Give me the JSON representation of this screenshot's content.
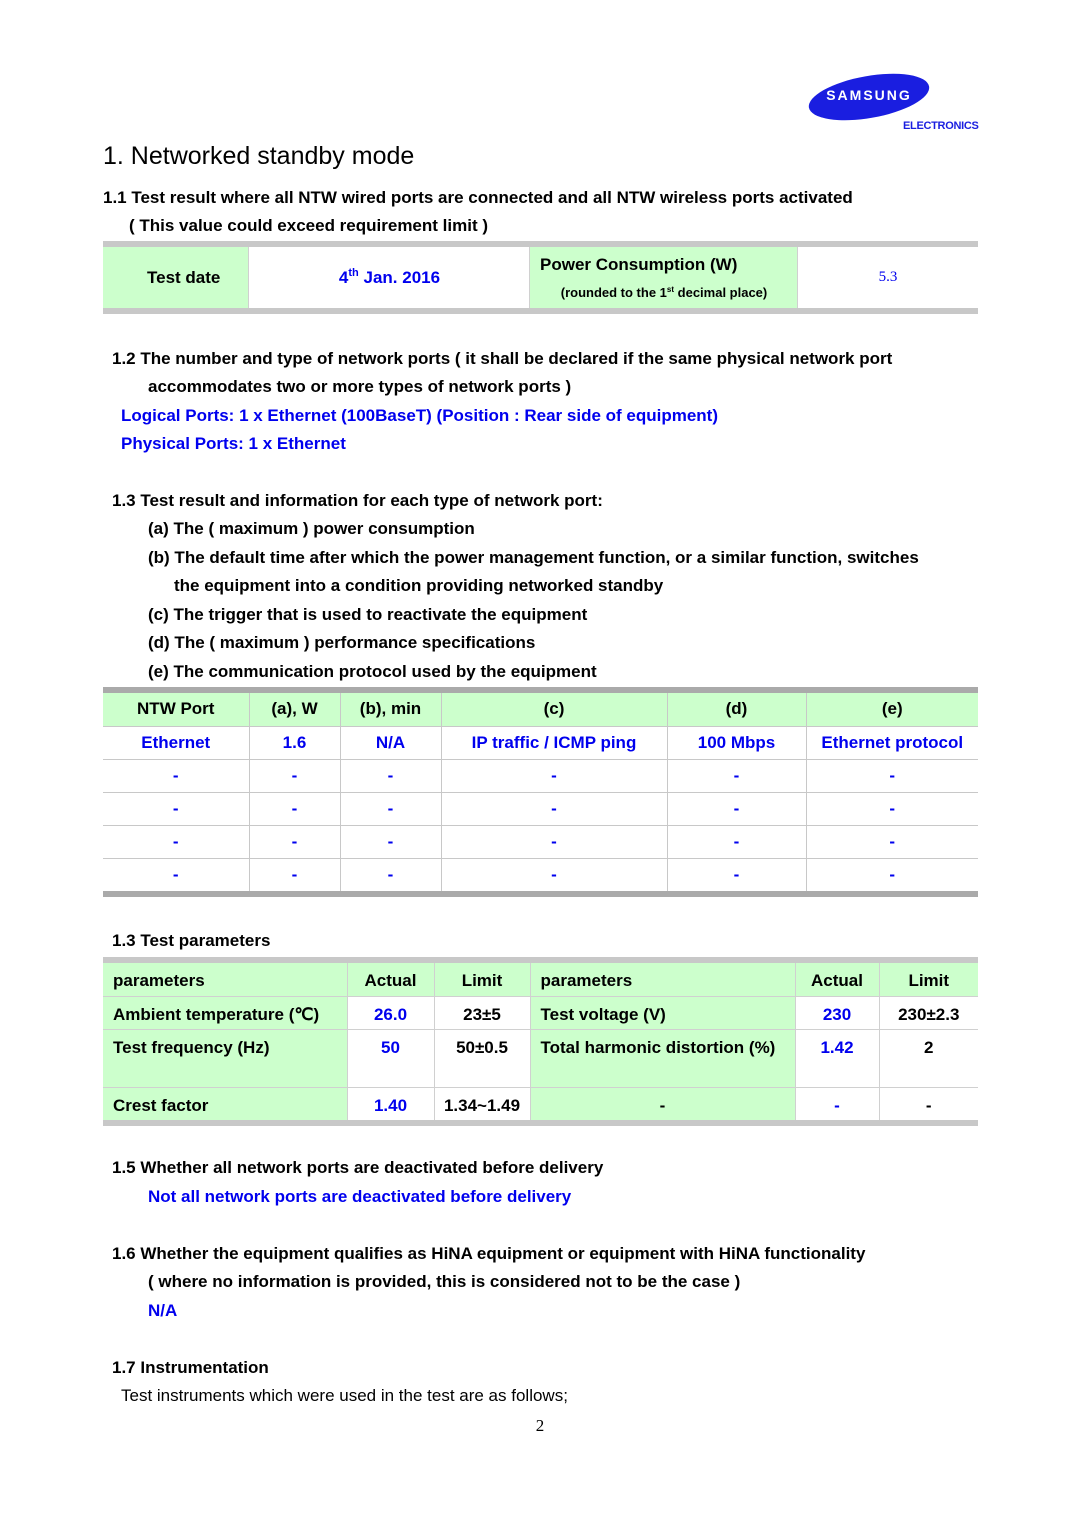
{
  "logo": {
    "brand": "SAMSUNG",
    "sub": "ELECTRONICS",
    "color": "#1a1ee0"
  },
  "title": "1. Networked standby mode",
  "s1_1": {
    "heading": "1.1 Test result where all NTW wired ports are connected and all NTW wireless ports activated",
    "note": "( This value could exceed requirement limit )",
    "table": {
      "test_date_label": "Test date",
      "test_date_day": "4",
      "test_date_suffix": "th",
      "test_date_rest": " Jan. 2016",
      "power_label": "Power Consumption (W)",
      "power_sub_pre": "(rounded to the 1",
      "power_sub_sup": "st",
      "power_sub_post": " decimal place)",
      "power_value": "5.3"
    }
  },
  "s1_2": {
    "heading_line1": "1.2 The number and type of network ports ( it shall be declared if the same physical network port",
    "heading_line2": "accommodates two or more types of network ports )",
    "logical": "Logical Ports: 1 x Ethernet (100BaseT) (Position : Rear side of equipment)",
    "physical": "Physical Ports: 1 x Ethernet"
  },
  "s1_3": {
    "heading": "1.3 Test result and information for each type of network port:",
    "items": [
      "(a) The ( maximum ) power consumption",
      "(b) The default time after which the power management function, or a similar function, switches",
      "the equipment into a condition providing networked standby",
      "(c) The trigger that is used to reactivate the equipment",
      "(d) The ( maximum ) performance specifications",
      "(e) The communication protocol used by the equipment"
    ],
    "ports_table": {
      "headers": [
        "NTW Port",
        "(a), W",
        "(b), min",
        "(c)",
        "(d)",
        "(e)"
      ],
      "rows": [
        [
          "Ethernet",
          "1.6",
          "N/A",
          "IP traffic / ICMP ping",
          "100 Mbps",
          "Ethernet protocol"
        ],
        [
          "-",
          "-",
          "-",
          "-",
          "-",
          "-"
        ],
        [
          "-",
          "-",
          "-",
          "-",
          "-",
          "-"
        ],
        [
          "-",
          "-",
          "-",
          "-",
          "-",
          "-"
        ],
        [
          "-",
          "-",
          "-",
          "-",
          "-",
          "-"
        ]
      ]
    }
  },
  "test_params": {
    "heading": "1.3 Test parameters",
    "headers": [
      "parameters",
      "Actual",
      "Limit",
      "parameters",
      "Actual",
      "Limit"
    ],
    "rows": [
      [
        "Ambient temperature (℃)",
        "26.0",
        "23±5",
        "Test voltage (V)",
        "230",
        "230±2.3"
      ],
      [
        "Test frequency (Hz)",
        "50",
        "50±0.5",
        "Total harmonic distortion (%)",
        "1.42",
        "2"
      ],
      [
        "Crest factor",
        "1.40",
        "1.34~1.49",
        "-",
        "-",
        "-"
      ]
    ]
  },
  "s1_5": {
    "heading": "1.5 Whether all network ports are deactivated before delivery",
    "answer": "Not all network ports are deactivated before delivery"
  },
  "s1_6": {
    "heading": "1.6 Whether the equipment qualifies as HiNA equipment or equipment with HiNA functionality",
    "note": "( where no information is provided, this is considered not to be the case )",
    "answer": "N/A"
  },
  "s1_7": {
    "heading": "1.7 Instrumentation",
    "text": "Test instruments which were used in the test are as follows;"
  },
  "page_number": "2"
}
